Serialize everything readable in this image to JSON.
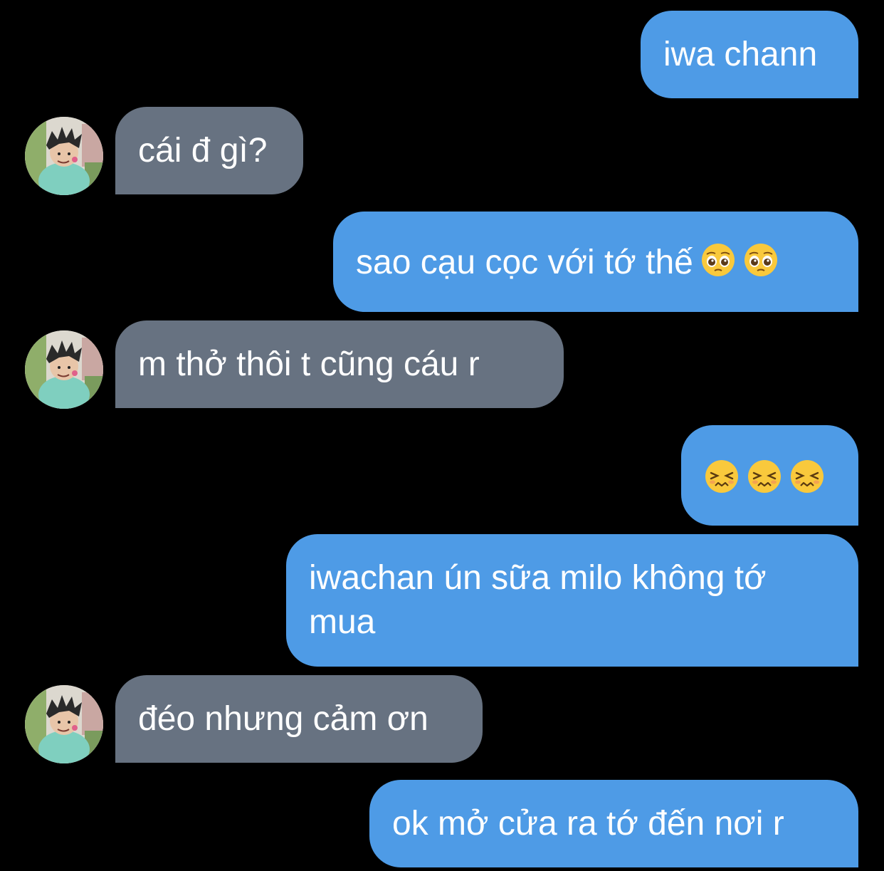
{
  "colors": {
    "background": "#000000",
    "sent_bubble": "#4e9be6",
    "received_bubble": "#677281",
    "text": "#ffffff"
  },
  "messages": [
    {
      "direction": "sent",
      "text": "iwa chann"
    },
    {
      "direction": "received",
      "text": "cái đ gì?",
      "avatar": "avatar-icon"
    },
    {
      "direction": "sent",
      "text": "sao cạu cọc với tớ thế",
      "emojis": [
        "pleading-face-icon",
        "pleading-face-icon"
      ]
    },
    {
      "direction": "received",
      "text": "m thở thôi t cũng cáu r",
      "avatar": "avatar-icon"
    },
    {
      "direction": "sent",
      "text": "",
      "emojis": [
        "persevering-face-icon",
        "persevering-face-icon",
        "persevering-face-icon"
      ]
    },
    {
      "direction": "sent",
      "text": "iwachan ún sữa milo không tớ mua"
    },
    {
      "direction": "received",
      "text": "đéo nhưng cảm ơn",
      "avatar": "avatar-icon"
    },
    {
      "direction": "sent",
      "text": "ok mở cửa ra tớ đến nơi r"
    }
  ]
}
